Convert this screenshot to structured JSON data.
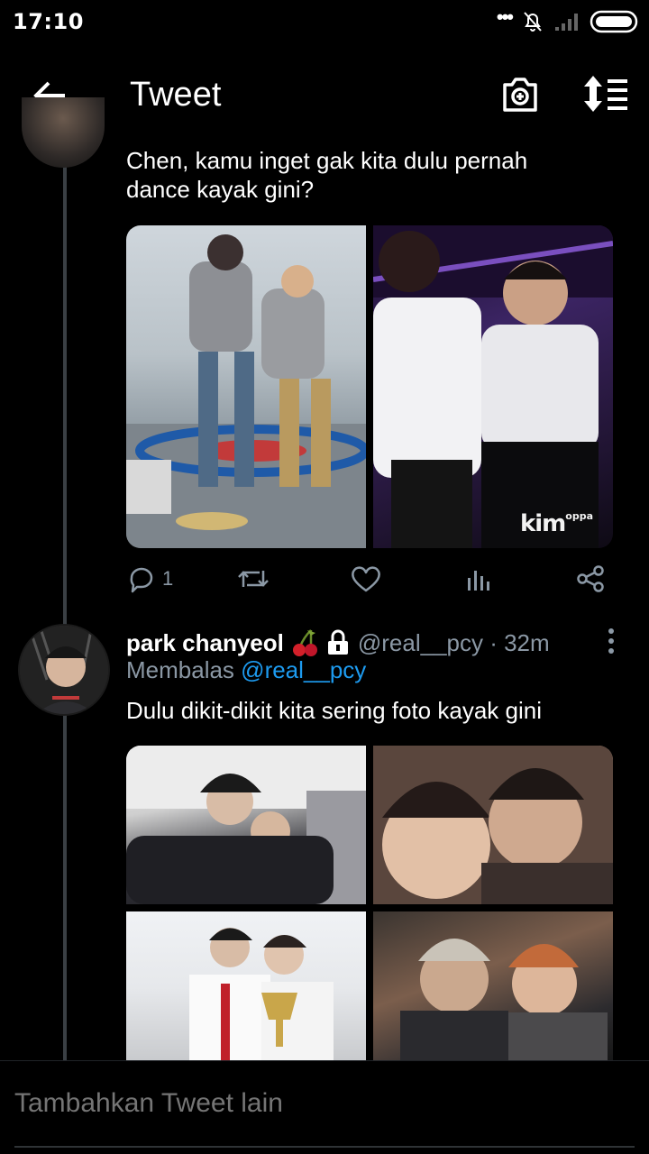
{
  "status_bar": {
    "time": "17:10"
  },
  "app_bar": {
    "title": "Tweet"
  },
  "thread": [
    {
      "text": "Chen, kamu inget gak kita dulu pernah dance kayak gini?",
      "media_count": 2,
      "media_watermark": "kim",
      "media_watermark_small": "oppa",
      "replies": "1"
    },
    {
      "display_name": "park chanyeol",
      "handle_time": "@real__pcy · 32m",
      "reply_prefix": "Membalas",
      "reply_handle": "@real__pcy",
      "text": "Dulu dikit-dikit kita sering foto kayak gini",
      "media_count": 4
    }
  ],
  "compose": {
    "placeholder": "Tambahkan Tweet lain"
  },
  "colors": {
    "background": "#000000",
    "accent": "#1d9bf0",
    "muted": "#8b98a5"
  }
}
